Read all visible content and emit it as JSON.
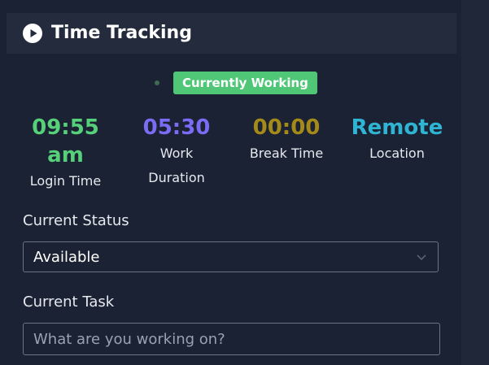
{
  "header": {
    "title": "Time Tracking",
    "icon": "play-circle-icon"
  },
  "status": {
    "badge": "Currently Working",
    "badge_color": "#4fc777"
  },
  "stats": {
    "login": {
      "value_line1": "09:55",
      "value_line2": "am",
      "label": "Login Time",
      "color": "#57d07a"
    },
    "work": {
      "value": "05:30",
      "label_line1": "Work",
      "label_line2": "Duration",
      "color": "#7b6cf5"
    },
    "break": {
      "value": "00:00",
      "label": "Break Time",
      "color": "#a48a19"
    },
    "location": {
      "value": "Remote",
      "label": "Location",
      "color": "#2fb4d3"
    }
  },
  "current_status": {
    "label": "Current Status",
    "selected": "Available",
    "icon": "chevron-down-icon"
  },
  "current_task": {
    "label": "Current Task",
    "value": "",
    "placeholder": "What are you working on?"
  }
}
